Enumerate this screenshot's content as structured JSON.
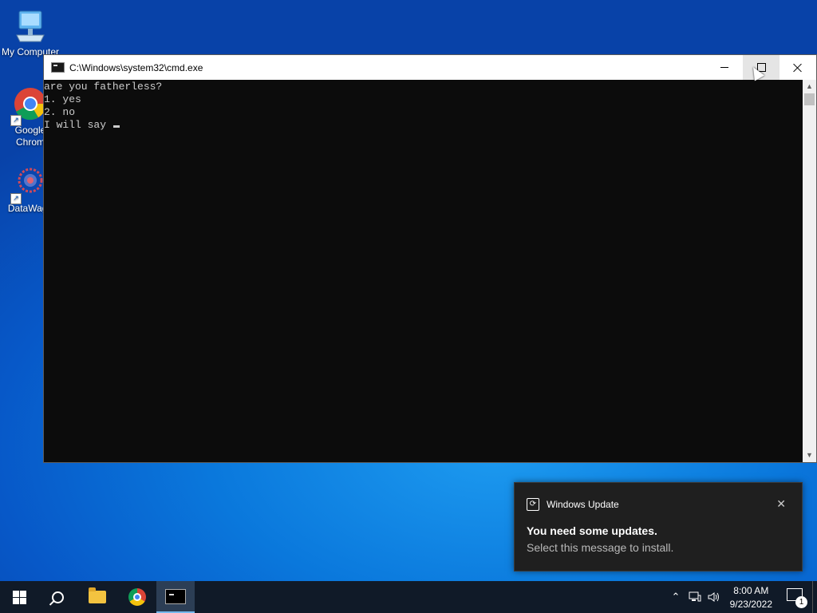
{
  "desktop": {
    "icons": [
      {
        "label": "My Computer",
        "icon": "computer-icon"
      },
      {
        "label": "Google Chrom",
        "icon": "chrome-icon"
      },
      {
        "label": "DataWago",
        "icon": "datawagon-icon"
      }
    ]
  },
  "window": {
    "title": "C:\\Windows\\system32\\cmd.exe",
    "console_lines": [
      "are you fatherless?",
      "1. yes",
      "2. no",
      "I will say "
    ]
  },
  "toast": {
    "app": "Windows Update",
    "headline": "You need some updates.",
    "message": "Select this message to install."
  },
  "taskbar": {
    "time": "8:00 AM",
    "date": "9/23/2022",
    "notification_count": "1",
    "pinned": [
      "start",
      "search",
      "file-explorer",
      "chrome",
      "command-prompt"
    ]
  },
  "colors": {
    "console_bg": "#0c0c0c",
    "console_fg": "#cccccc",
    "taskbar_bg": "#101a28",
    "toast_bg": "#1f1f1f",
    "desktop_blue": "#0a78dc"
  }
}
